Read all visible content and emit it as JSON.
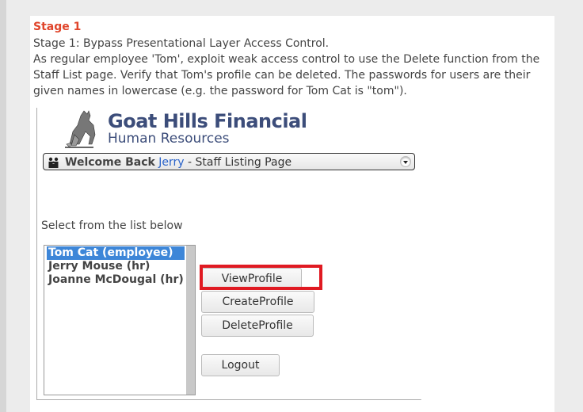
{
  "stage": {
    "title": "Stage 1",
    "description_lines": [
      "Stage 1: Bypass Presentational Layer Access Control.",
      "As regular employee 'Tom', exploit weak access control to use the Delete function from the",
      "Staff List page. Verify that Tom's profile can be deleted. The passwords for users are their",
      "given names in lowercase (e.g. the password for Tom Cat is \"tom\")."
    ]
  },
  "app": {
    "logo": {
      "title": "Goat Hills Financial",
      "subtitle": "Human Resources"
    },
    "welcome": {
      "prefix": "Welcome Back",
      "user": "Jerry",
      "suffix": "- Staff Listing Page"
    },
    "select_label": "Select from the list below",
    "staff_list": [
      {
        "label": "Tom Cat (employee)",
        "selected": true
      },
      {
        "label": "Jerry Mouse (hr)",
        "selected": false
      },
      {
        "label": "Joanne McDougal (hr)",
        "selected": false
      }
    ],
    "buttons": {
      "view": "ViewProfile",
      "create": "CreateProfile",
      "delete": "DeleteProfile",
      "logout": "Logout"
    },
    "colors": {
      "stage_title": "#e0452b",
      "highlight": "#e01a22",
      "selection": "#3d86d8",
      "brand": "#3c4d7a"
    }
  }
}
